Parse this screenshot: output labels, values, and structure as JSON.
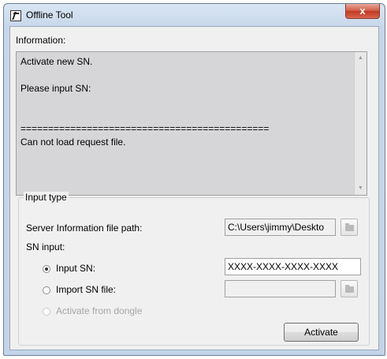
{
  "window": {
    "title": "Offline Tool",
    "close_glyph": "x"
  },
  "info": {
    "label": "Information:",
    "text": "Activate new SN.\n\nPlease input SN:\n\n\n=============================================\nCan not load request file."
  },
  "input_type": {
    "title": "Input type",
    "server_path_label": "Server Information file path:",
    "server_path_value": "C:\\Users\\jimmy\\Deskto",
    "sn_input_label": "SN input:",
    "options": [
      {
        "label": "Input SN:",
        "checked": true,
        "enabled": true
      },
      {
        "label": "Import SN file:",
        "checked": false,
        "enabled": true
      },
      {
        "label": "Activate from dongle",
        "checked": false,
        "enabled": false
      }
    ],
    "sn_value": "XXXX-XXXX-XXXX-XXXX",
    "sn_file_value": ""
  },
  "buttons": {
    "activate": "Activate"
  },
  "icons": {
    "app": "app-icon",
    "browse": "folder-icon",
    "scroll_up": "scroll-up-arrow-icon",
    "scroll_down": "scroll-down-arrow-icon"
  },
  "colors": {
    "close_button": "#c94a33",
    "info_background": "#d6d6d9",
    "frame": "#c7d7e9"
  }
}
